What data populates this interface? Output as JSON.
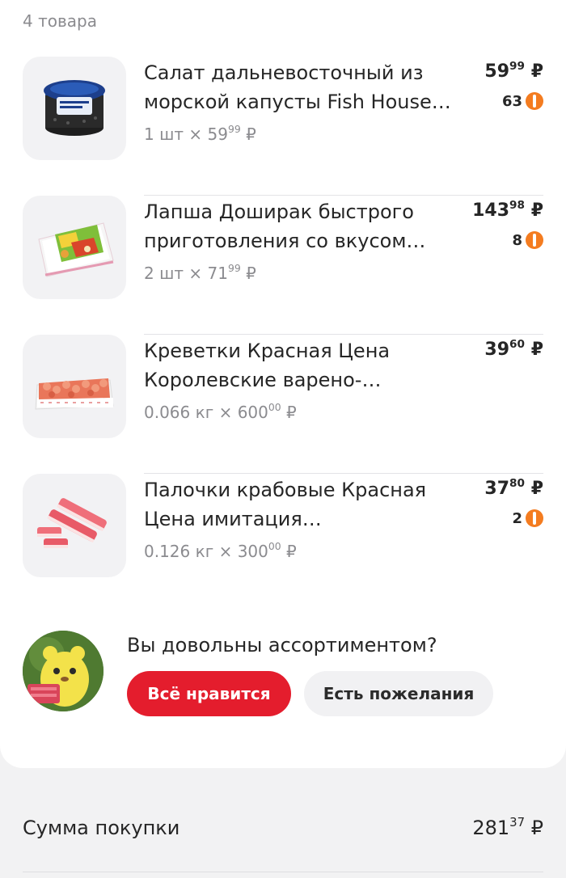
{
  "header": {
    "count": "4 товара"
  },
  "items": [
    {
      "name": "Салат дальневосточный из морской капусты Fish House…",
      "qty": "1 шт",
      "unit_int": "59",
      "unit_dec": "99",
      "price_int": "59",
      "price_dec": "99",
      "bonus": "63"
    },
    {
      "name": "Лапша Доширак быстрого приготовления со вкусом…",
      "qty": "2 шт",
      "unit_int": "71",
      "unit_dec": "99",
      "price_int": "143",
      "price_dec": "98",
      "bonus": "8"
    },
    {
      "name": "Креветки Красная Цена Королевские варено-…",
      "qty": "0.066 кг",
      "unit_int": "600",
      "unit_dec": "00",
      "price_int": "39",
      "price_dec": "60",
      "bonus": ""
    },
    {
      "name": "Палочки крабовые Красная Цена имитация…",
      "qty": "0.126 кг",
      "unit_int": "300",
      "unit_dec": "00",
      "price_int": "37",
      "price_dec": "80",
      "bonus": "2"
    }
  ],
  "multiply_sign": "×",
  "currency": "₽",
  "feedback": {
    "question": "Вы довольны ассортиментом?",
    "like_label": "Всё нравится",
    "wish_label": "Есть пожелания"
  },
  "summary": {
    "label": "Сумма покупки",
    "total_int": "281",
    "total_dec": "37"
  },
  "colors": {
    "accent": "#e41d2d",
    "bonus_coin": "#f47c20",
    "muted": "#8b8b8f"
  }
}
